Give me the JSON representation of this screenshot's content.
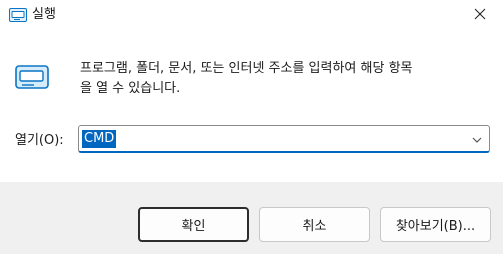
{
  "window": {
    "title": "실행"
  },
  "icons": {
    "app": "run-dialog-icon",
    "close": "close-icon",
    "dropdown": "chevron-down-icon"
  },
  "main": {
    "description_line1": "프로그램, 폴더, 문서, 또는 인터넷 주소를 입력하여 해당 항목",
    "description_line2": "을 열 수 있습니다.",
    "open_label": "열기(O):",
    "open_value": "CMD"
  },
  "buttons": {
    "ok": "확인",
    "cancel": "취소",
    "browse": "찾아보기(B)..."
  },
  "colors": {
    "accent": "#0067c0",
    "footer_bg": "#f0f0f0"
  }
}
